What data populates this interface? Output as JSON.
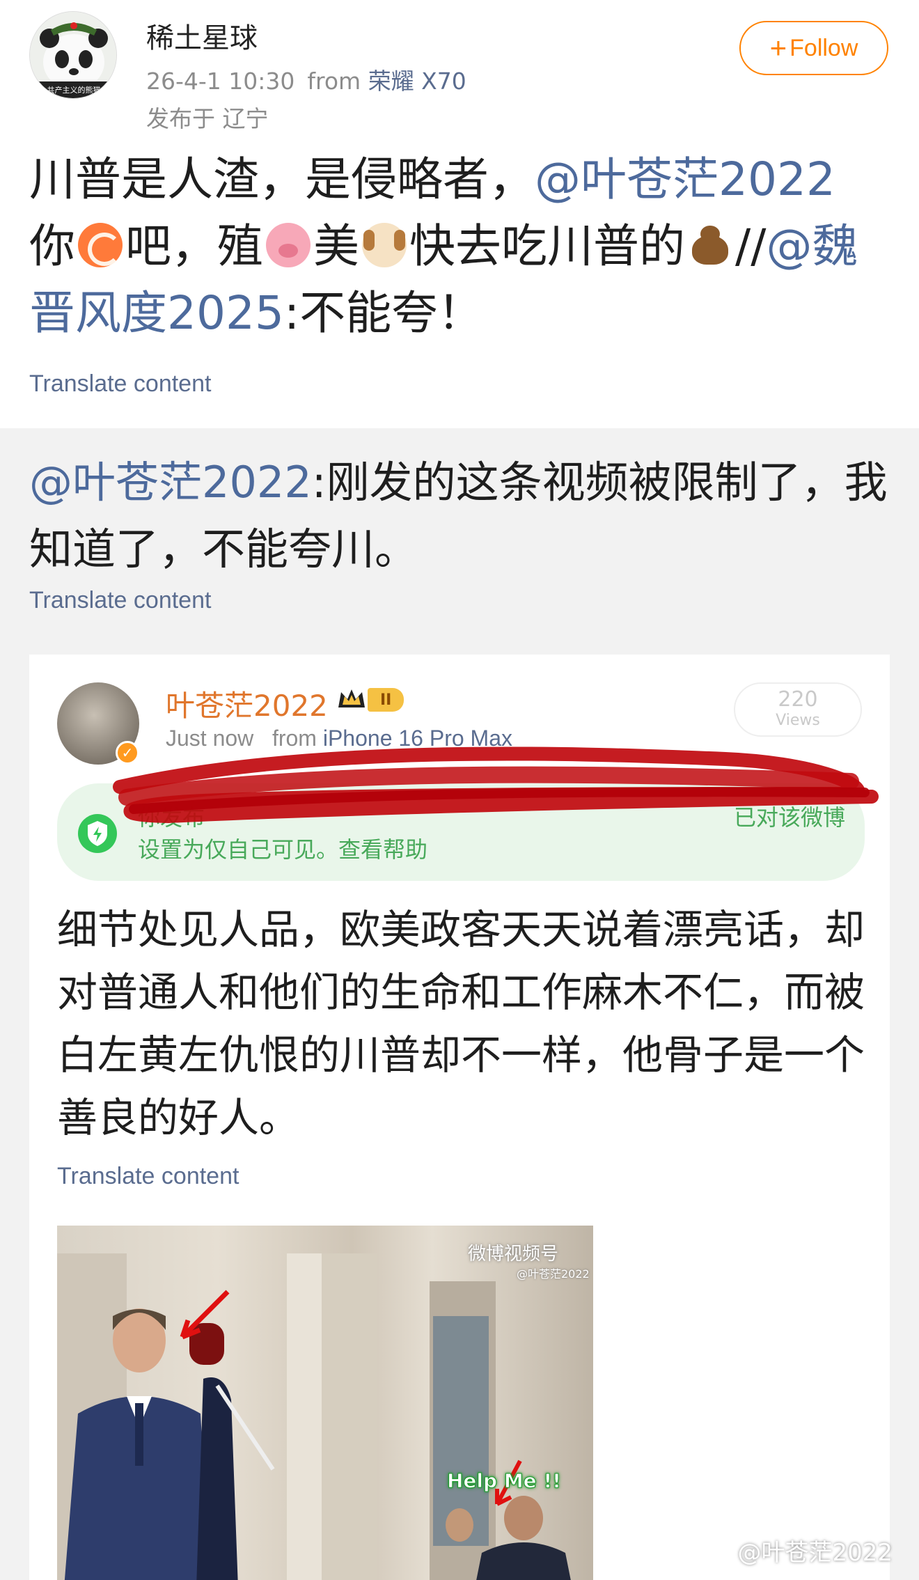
{
  "post": {
    "author": "稀土星球",
    "avatar_caption": "共产主义的熊猫",
    "time": "26-4-1 10:30",
    "from_label": "from",
    "device": "荣耀 X70",
    "location": "发布于 辽宁",
    "follow_label": "Follow",
    "text": {
      "t1": "川普是人渣，是侵略者，",
      "mention1": "@叶苍茫2022",
      "t2": "你",
      "t3": "吧，殖",
      "t4": "美",
      "t5": "快去吃川普的",
      "t6": "//",
      "mention2": "@魏晋风度2025",
      "t7": ":不能夸！"
    },
    "translate_label": "Translate content"
  },
  "repost": {
    "mention": "@叶苍茫2022",
    "text": ":刚发的这条视频被限制了，我知道了，不能夸川。",
    "translate_label": "Translate content"
  },
  "screenshot": {
    "author": "叶苍茫2022",
    "level": "II",
    "time": "Just now",
    "from_label": "from",
    "device": "iPhone 16 Pro Max",
    "views_count": "220",
    "views_label": "Views",
    "notice_line1": "你发布",
    "notice_line1_end": "已对该微博",
    "notice_line2": "设置为仅自己可见。查看帮助",
    "body": "细节处见人品，欧美政客天天说着漂亮话，却对普通人和他们的生命和工作麻木不仁，而被白左黄左仇恨的川普却不一样，他骨子是一个善良的好人。",
    "translate_label": "Translate content",
    "video_watermark": "微博视频号",
    "video_watermark_sub": "@叶苍茫2022",
    "video_caption": "Help Me !!"
  },
  "footer_watermark": "@叶苍茫2022",
  "colors": {
    "accent": "#ff8200",
    "link": "#4d6a9c",
    "muted": "#8c8c8c",
    "notice_green": "#48a95a",
    "scribble": "#c0090e"
  }
}
